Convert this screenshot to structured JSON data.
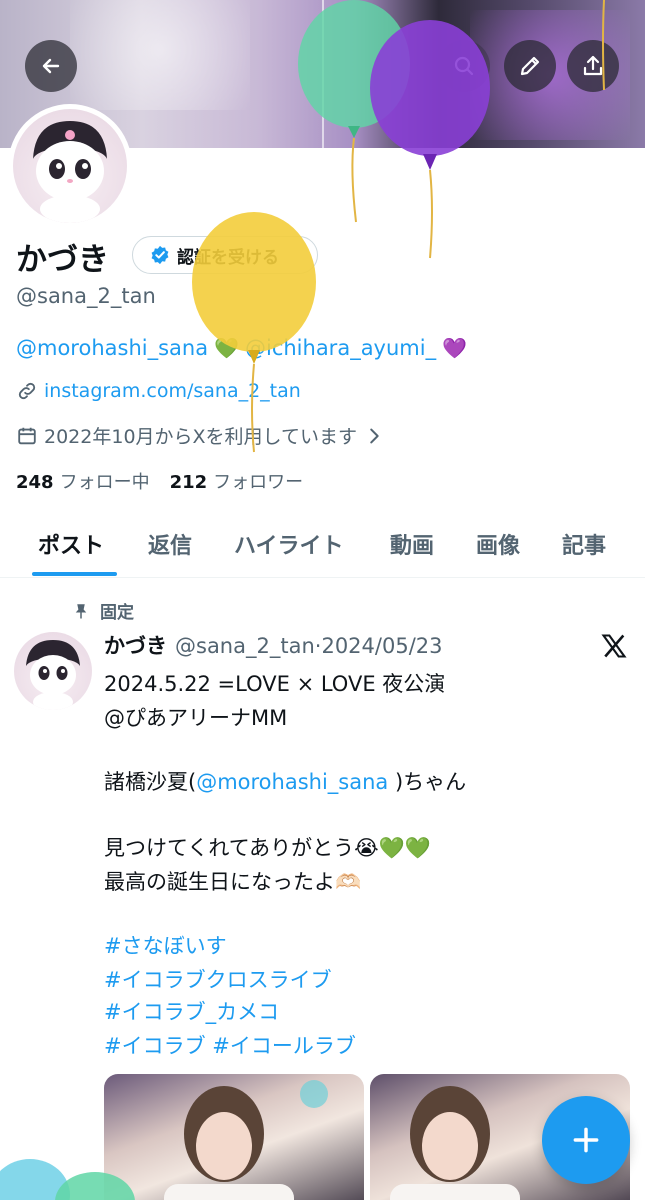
{
  "profile": {
    "name": "かづき",
    "verify_label": "認証を受ける",
    "handle": "@sana_2_tan",
    "bio_mention_1": "@morohashi_sana",
    "bio_heart_1": "💚",
    "bio_mention_2": "@ichihara_ayumi_",
    "bio_heart_2": "💜",
    "website": "instagram.com/sana_2_tan",
    "joined": "2022年10月からXを利用しています",
    "following_count": "248",
    "following_label": "フォロー中",
    "followers_count": "212",
    "followers_label": "フォロワー"
  },
  "tabs": [
    {
      "label": "ポスト"
    },
    {
      "label": "返信"
    },
    {
      "label": "ハイライト"
    },
    {
      "label": "動画"
    },
    {
      "label": "画像"
    },
    {
      "label": "記事"
    }
  ],
  "post": {
    "pinned_label": "固定",
    "author_name": "かづき",
    "author_handle": "@sana_2_tan",
    "separator": "·",
    "date": "2024/05/23",
    "line1": "2024.5.22 =LOVE × LOVE 夜公演",
    "line2": "@ぴあアリーナMM",
    "line3_pre": "諸橋沙夏(",
    "line3_mention": "@morohashi_sana",
    "line3_post": " )ちゃん",
    "line4": "見つけてくれてありがとう😭💚💚",
    "line5": "最高の誕生日になったよ🫶🏻",
    "tag1": "#さなぼいす",
    "tag2": "#イコラブクロスライブ",
    "tag3": "#イコラブ_カメコ",
    "tag4": "#イコラブ #イコールラブ"
  },
  "icons": {
    "back": "arrow-left-icon",
    "search": "search-icon",
    "edit": "pencil-icon",
    "share": "share-icon",
    "link": "link-icon",
    "calendar": "calendar-icon",
    "pin": "pin-icon",
    "x": "x-logo-icon",
    "compose": "plus-icon"
  },
  "colors": {
    "accent": "#1d9bf0",
    "muted": "#536471",
    "text": "#0f1419",
    "balloon_green": "#5fd6a6",
    "balloon_purple": "#8a3fd6",
    "balloon_yellow": "#f3cd3b"
  }
}
